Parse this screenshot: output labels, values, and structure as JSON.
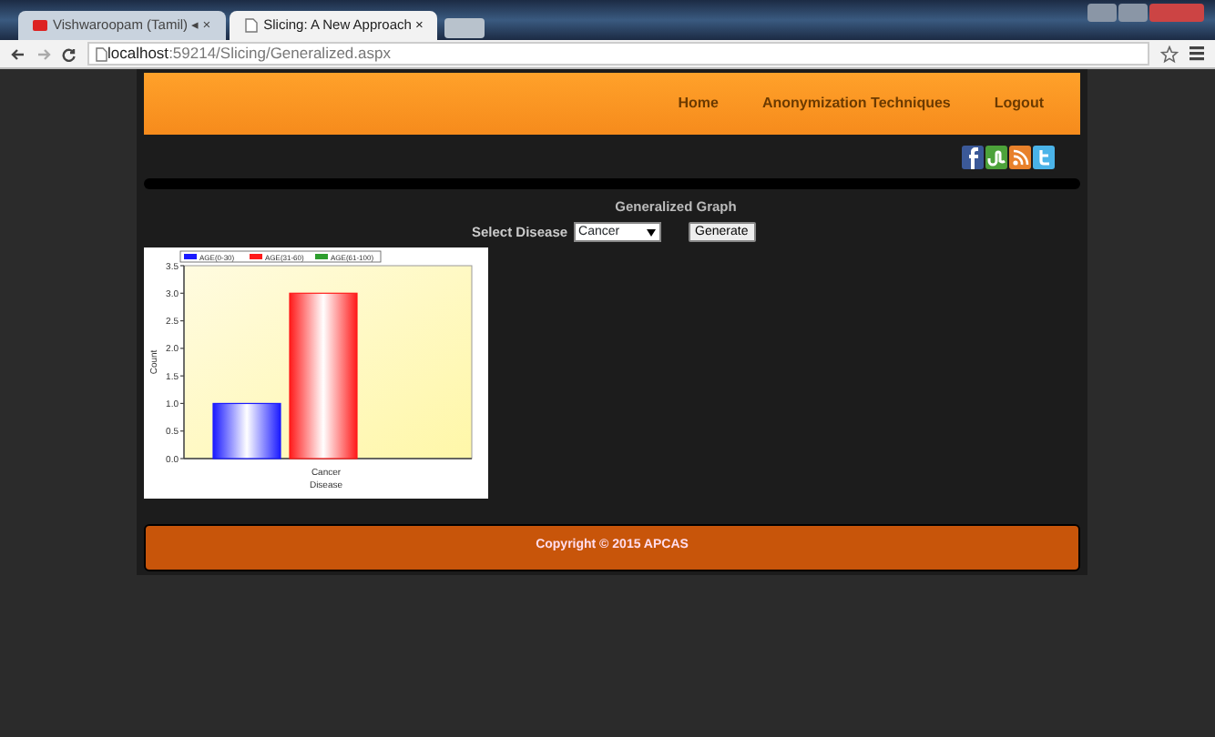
{
  "browser": {
    "tabs": [
      {
        "title": "Vishwaroopam (Tamil) ◂ ×",
        "kind": "video",
        "selected": false
      },
      {
        "title": "Slicing: A New Approach ×",
        "kind": "page",
        "selected": true
      }
    ],
    "address": {
      "host": "localhost",
      "path": ":59214/Slicing/Generalized.aspx"
    }
  },
  "nav": {
    "items": [
      {
        "label": "Home"
      },
      {
        "label": "Anonymization Techniques"
      },
      {
        "label": "Logout"
      }
    ]
  },
  "social": [
    {
      "kind": "facebook",
      "color": "#3b5998"
    },
    {
      "kind": "stumble",
      "color": "#4ca23a"
    },
    {
      "kind": "rss",
      "color": "#e8812b"
    },
    {
      "kind": "twitter",
      "color": "#4ab3e8"
    }
  ],
  "content": {
    "title": "Generalized Graph",
    "select_label": "Select Disease",
    "select_value": "Cancer",
    "button": "Generate",
    "chart_data": {
      "type": "bar",
      "xlabel": "Disease",
      "ylabel": "Count",
      "categories": [
        "Cancer"
      ],
      "series": [
        {
          "name": "AGE(0-30)",
          "color": "#1a1aff",
          "values": [
            1
          ]
        },
        {
          "name": "AGE(31-60)",
          "color": "#ff1a1a",
          "values": [
            3
          ]
        },
        {
          "name": "AGE(61-100)",
          "color": "#2e9e2e",
          "values": [
            0
          ]
        }
      ],
      "legend": "top",
      "ylim": [
        0,
        3.5
      ],
      "yticks": [
        {
          "value": 0,
          "label": "0.0"
        },
        {
          "value": 0.5,
          "label": "0.5"
        },
        {
          "value": 1,
          "label": "1.0"
        },
        {
          "value": 1.5,
          "label": "1.5"
        },
        {
          "value": 2,
          "label": "2.0"
        },
        {
          "value": 2.5,
          "label": "2.5"
        },
        {
          "value": 3,
          "label": "3.0"
        },
        {
          "value": 3.5,
          "label": "3.5"
        }
      ]
    }
  },
  "footer": "Copyright © 2015 APCAS"
}
